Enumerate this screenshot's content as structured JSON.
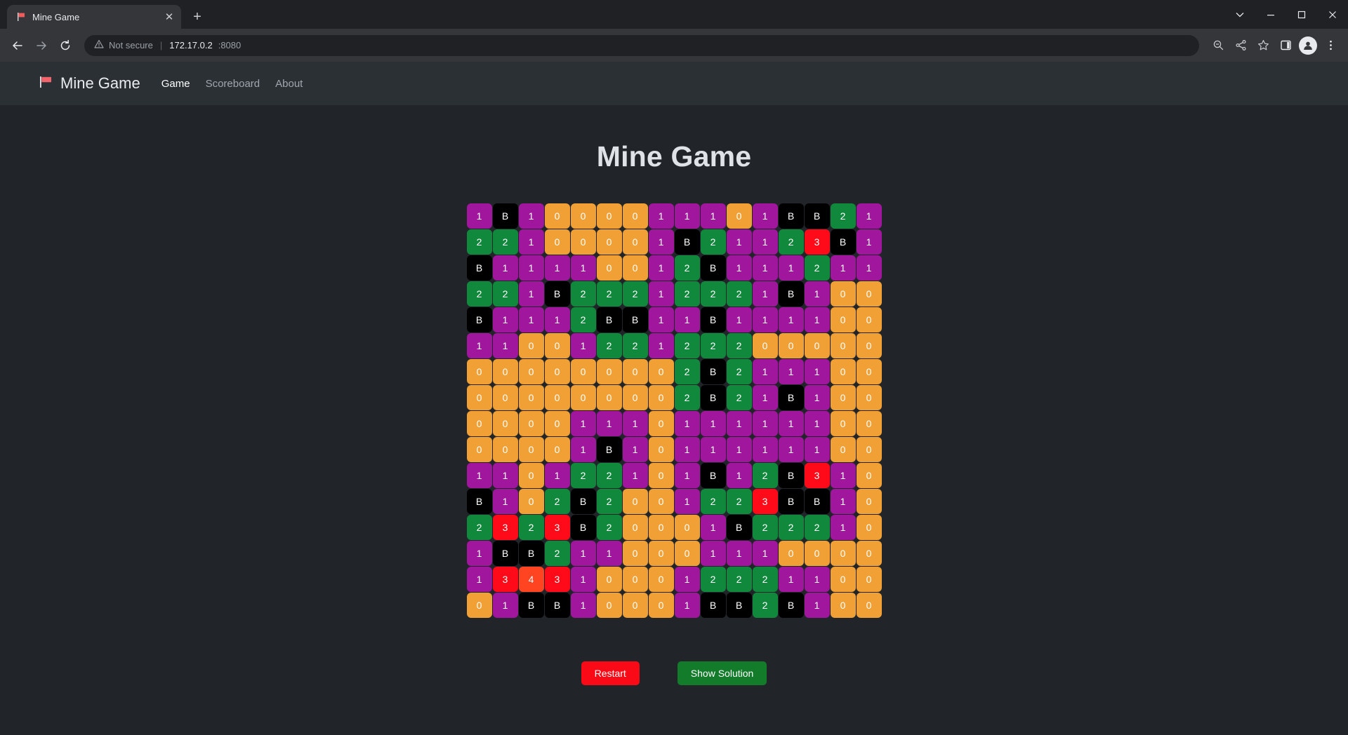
{
  "browser": {
    "tab": {
      "title": "Mine Game",
      "favicon": "flag-icon",
      "close_label": "✕"
    },
    "new_tab_label": "+",
    "window_controls": {
      "minimize": "—",
      "maximize": "❐",
      "close": "✕",
      "dropdown": "⌄"
    },
    "nav": {
      "back": "←",
      "forward": "→",
      "reload": "↻"
    },
    "omnibox": {
      "warning_icon": "not-secure-warning-icon",
      "security_label": "Not secure",
      "separator": "|",
      "url_host": "172.17.0.2",
      "url_port": ":8080"
    },
    "toolbar_right": {
      "zoom_out": "zoom-out-icon",
      "share": "share-icon",
      "bookmark": "star-icon",
      "sidepanel": "side-panel-icon",
      "profile": "profile-avatar-icon",
      "menu": "three-dot-menu-icon"
    }
  },
  "site": {
    "brand": {
      "flag": "🚩",
      "name": "Mine Game"
    },
    "nav_links": [
      {
        "label": "Game",
        "active": true
      },
      {
        "label": "Scoreboard",
        "active": false
      },
      {
        "label": "About",
        "active": false
      }
    ],
    "title": "Mine Game",
    "buttons": {
      "restart": "Restart",
      "solution": "Show Solution"
    },
    "colors": {
      "zero": "#f0a035",
      "one": "#a0169c",
      "two": "#11893d",
      "three": "#ff0a19",
      "four": "#ff4422",
      "bomb": "#000000",
      "restart": "#fa0a16",
      "solution": "#127c2a",
      "page_bg": "#212529",
      "navbar_bg": "#2b3035"
    }
  },
  "board": {
    "rows": 16,
    "cols": 16,
    "grid": [
      [
        "1",
        "B",
        "1",
        "0",
        "0",
        "0",
        "0",
        "1",
        "1",
        "1",
        "0",
        "1",
        "B",
        "B",
        "2",
        "1"
      ],
      [
        "2",
        "2",
        "1",
        "0",
        "0",
        "0",
        "0",
        "1",
        "B",
        "2",
        "1",
        "1",
        "2",
        "3",
        "B",
        "1"
      ],
      [
        "B",
        "1",
        "1",
        "1",
        "1",
        "0",
        "0",
        "1",
        "2",
        "B",
        "1",
        "1",
        "1",
        "2",
        "1",
        "1"
      ],
      [
        "2",
        "2",
        "1",
        "B",
        "2",
        "2",
        "2",
        "1",
        "2",
        "2",
        "2",
        "1",
        "B",
        "1",
        "0",
        "0"
      ],
      [
        "B",
        "1",
        "1",
        "1",
        "2",
        "B",
        "B",
        "1",
        "1",
        "B",
        "1",
        "1",
        "1",
        "1",
        "0",
        "0"
      ],
      [
        "1",
        "1",
        "0",
        "0",
        "1",
        "2",
        "2",
        "1",
        "2",
        "2",
        "2",
        "0",
        "0",
        "0",
        "0",
        "0"
      ],
      [
        "0",
        "0",
        "0",
        "0",
        "0",
        "0",
        "0",
        "0",
        "2",
        "B",
        "2",
        "1",
        "1",
        "1",
        "0",
        "0"
      ],
      [
        "0",
        "0",
        "0",
        "0",
        "0",
        "0",
        "0",
        "0",
        "2",
        "B",
        "2",
        "1",
        "B",
        "1",
        "0",
        "0"
      ],
      [
        "0",
        "0",
        "0",
        "0",
        "1",
        "1",
        "1",
        "0",
        "1",
        "1",
        "1",
        "1",
        "1",
        "1",
        "0",
        "0"
      ],
      [
        "0",
        "0",
        "0",
        "0",
        "1",
        "B",
        "1",
        "0",
        "1",
        "1",
        "1",
        "1",
        "1",
        "1",
        "0",
        "0"
      ],
      [
        "1",
        "1",
        "0",
        "1",
        "2",
        "2",
        "1",
        "0",
        "1",
        "B",
        "1",
        "2",
        "B",
        "3",
        "1",
        "0"
      ],
      [
        "B",
        "1",
        "0",
        "2",
        "B",
        "2",
        "0",
        "0",
        "1",
        "2",
        "2",
        "3",
        "B",
        "B",
        "1",
        "0"
      ],
      [
        "2",
        "3",
        "2",
        "3",
        "B",
        "2",
        "0",
        "0",
        "0",
        "1",
        "B",
        "2",
        "2",
        "2",
        "1",
        "0"
      ],
      [
        "1",
        "B",
        "B",
        "2",
        "1",
        "1",
        "0",
        "0",
        "0",
        "1",
        "1",
        "1",
        "0",
        "0",
        "0",
        "0"
      ],
      [
        "1",
        "3",
        "4",
        "3",
        "1",
        "0",
        "0",
        "0",
        "1",
        "2",
        "2",
        "2",
        "1",
        "1",
        "0",
        "0"
      ],
      [
        "0",
        "1",
        "B",
        "B",
        "1",
        "0",
        "0",
        "0",
        "1",
        "B",
        "B",
        "2",
        "B",
        "1",
        "0",
        "0"
      ]
    ]
  }
}
